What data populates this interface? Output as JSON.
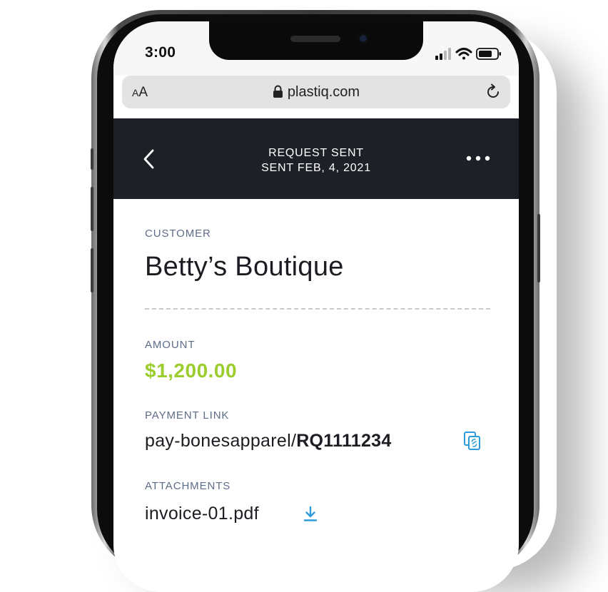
{
  "status_bar": {
    "time": "3:00"
  },
  "browser": {
    "text_size_label_small": "A",
    "text_size_label_large": "A",
    "url": "plastiq.com"
  },
  "header": {
    "title_line1": "REQUEST SENT",
    "title_line2": "SENT FEB, 4, 2021"
  },
  "customer": {
    "label": "CUSTOMER",
    "name": "Betty’s Boutique"
  },
  "amount": {
    "label": "AMOUNT",
    "value": "$1,200.00"
  },
  "payment_link": {
    "label": "PAYMENT LINK",
    "prefix": "pay-bonesapparel/",
    "code": "RQ1111234"
  },
  "attachments": {
    "label": "ATTACHMENTS",
    "file_name": "invoice-01.pdf"
  },
  "colors": {
    "header_bg": "#1d2027",
    "amount": "#9ccd2e",
    "label": "#5d6c87",
    "icon_accent": "#2d9cdb"
  },
  "icons": [
    "lock-icon",
    "reload-icon",
    "back-icon",
    "more-icon",
    "copy-icon",
    "download-icon",
    "signal-icon",
    "wifi-icon",
    "battery-icon"
  ]
}
